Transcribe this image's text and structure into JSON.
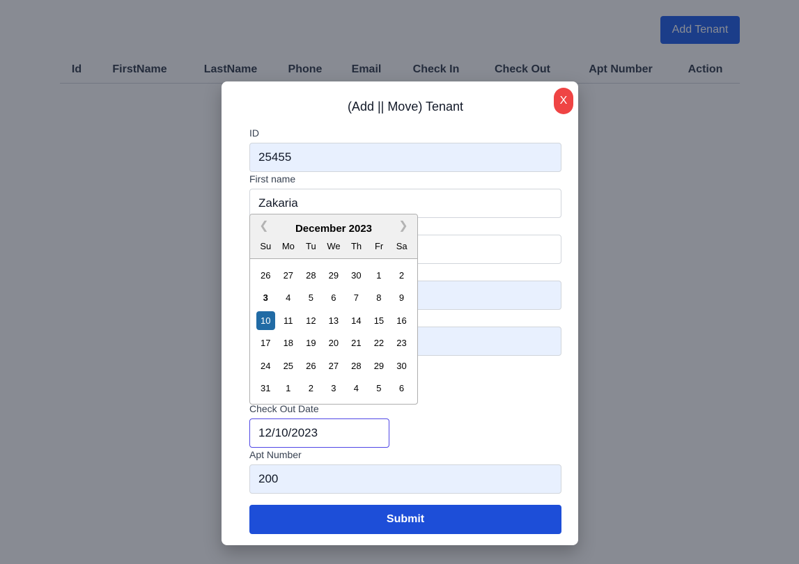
{
  "header": {
    "add_tenant_label": "Add Tenant"
  },
  "table": {
    "columns": [
      "Id",
      "FirstName",
      "LastName",
      "Phone",
      "Email",
      "Check In",
      "Check Out",
      "Apt Number",
      "Action"
    ]
  },
  "modal": {
    "title": "(Add || Move) Tenant",
    "close_label": "X",
    "fields": {
      "id": {
        "label": "ID",
        "value": "25455"
      },
      "first_name": {
        "label": "First name",
        "value": "Zakaria"
      },
      "last_name": {
        "value": ""
      },
      "phone": {
        "value": ""
      },
      "email": {
        "value": ""
      },
      "check_out": {
        "label": "Check Out Date",
        "value": "12/10/2023"
      },
      "apt_number": {
        "label": "Apt Number",
        "value": "200"
      }
    },
    "submit_label": "Submit"
  },
  "datepicker": {
    "month_label": "December 2023",
    "prev_icon": "chevron-left-icon",
    "next_icon": "chevron-right-icon",
    "weekdays": [
      "Su",
      "Mo",
      "Tu",
      "We",
      "Th",
      "Fr",
      "Sa"
    ],
    "weeks": [
      [
        "26",
        "27",
        "28",
        "29",
        "30",
        "1",
        "2"
      ],
      [
        "3",
        "4",
        "5",
        "6",
        "7",
        "8",
        "9"
      ],
      [
        "10",
        "11",
        "12",
        "13",
        "14",
        "15",
        "16"
      ],
      [
        "17",
        "18",
        "19",
        "20",
        "21",
        "22",
        "23"
      ],
      [
        "24",
        "25",
        "26",
        "27",
        "28",
        "29",
        "30"
      ],
      [
        "31",
        "1",
        "2",
        "3",
        "4",
        "5",
        "6"
      ]
    ],
    "today_day": "3",
    "selected_day": "10",
    "selected_color": "#216ba5"
  },
  "colors": {
    "primary": "#1d4ed8",
    "danger": "#ef4444",
    "autofill": "#e8f0fe"
  }
}
